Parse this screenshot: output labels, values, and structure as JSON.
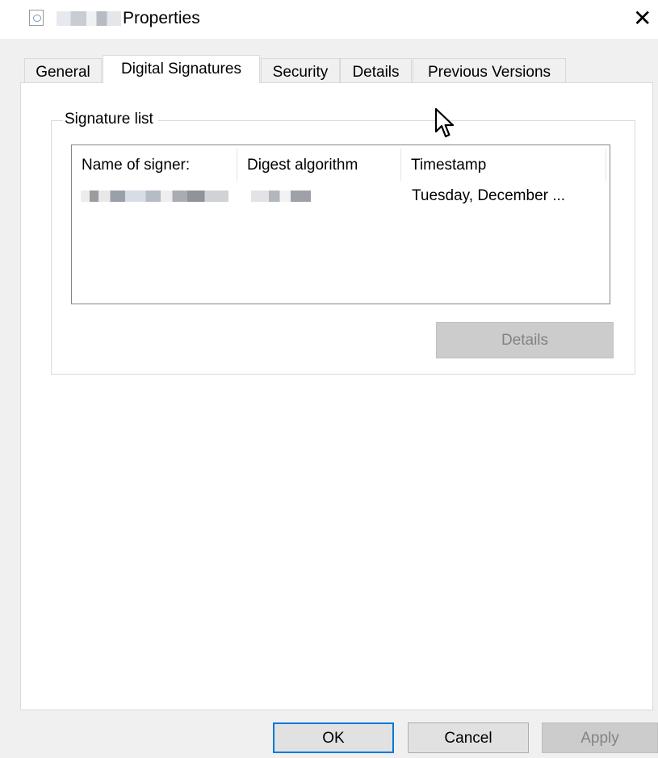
{
  "window": {
    "title_suffix": "Properties",
    "close_glyph": "✕"
  },
  "tabs": [
    {
      "label": "General",
      "active": false
    },
    {
      "label": "Digital Signatures",
      "active": true
    },
    {
      "label": "Security",
      "active": false
    },
    {
      "label": "Details",
      "active": false
    },
    {
      "label": "Previous Versions",
      "active": false
    }
  ],
  "signature_group": {
    "legend": "Signature list",
    "columns": [
      "Name of signer:",
      "Digest algorithm",
      "Timestamp"
    ],
    "rows": [
      {
        "timestamp": "Tuesday, December ..."
      }
    ],
    "details_button": "Details"
  },
  "footer": {
    "ok": "OK",
    "cancel": "Cancel",
    "apply": "Apply"
  },
  "colors": {
    "dialog_bg": "#f0f0f0",
    "panel_bg": "#ffffff",
    "default_button_border": "#0078d7"
  }
}
